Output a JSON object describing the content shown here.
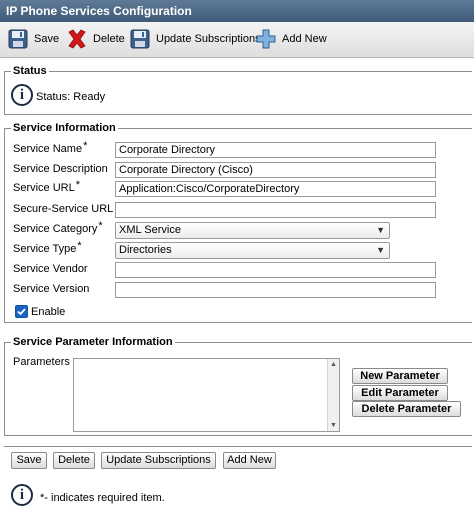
{
  "window": {
    "title": "IP Phone Services Configuration"
  },
  "toolbar": {
    "save_label": "Save",
    "delete_label": "Delete",
    "update_label": "Update Subscriptions",
    "add_label": "Add New"
  },
  "status": {
    "legend": "Status",
    "text": "Status: Ready"
  },
  "service_info": {
    "legend": "Service Information",
    "name_label": "Service Name",
    "name_value": "Corporate Directory",
    "description_label": "Service Description",
    "description_value": "Corporate Directory (Cisco)",
    "url_label": "Service URL",
    "url_value": "Application:Cisco/CorporateDirectory",
    "secure_url_label": "Secure-Service URL",
    "secure_url_value": "",
    "category_label": "Service Category",
    "category_value": "XML Service",
    "type_label": "Service Type",
    "type_value": "Directories",
    "vendor_label": "Service Vendor",
    "vendor_value": "",
    "version_label": "Service Version",
    "version_value": "",
    "enable_label": "Enable",
    "required_marker": "*"
  },
  "parameters": {
    "legend": "Service Parameter Information",
    "label": "Parameters",
    "new_label": "New Parameter",
    "edit_label": "Edit Parameter",
    "delete_label": "Delete Parameter"
  },
  "bottom": {
    "save_label": "Save",
    "delete_label": "Delete",
    "update_label": "Update Subscriptions",
    "add_label": "Add New",
    "note": "*- indicates required item."
  }
}
